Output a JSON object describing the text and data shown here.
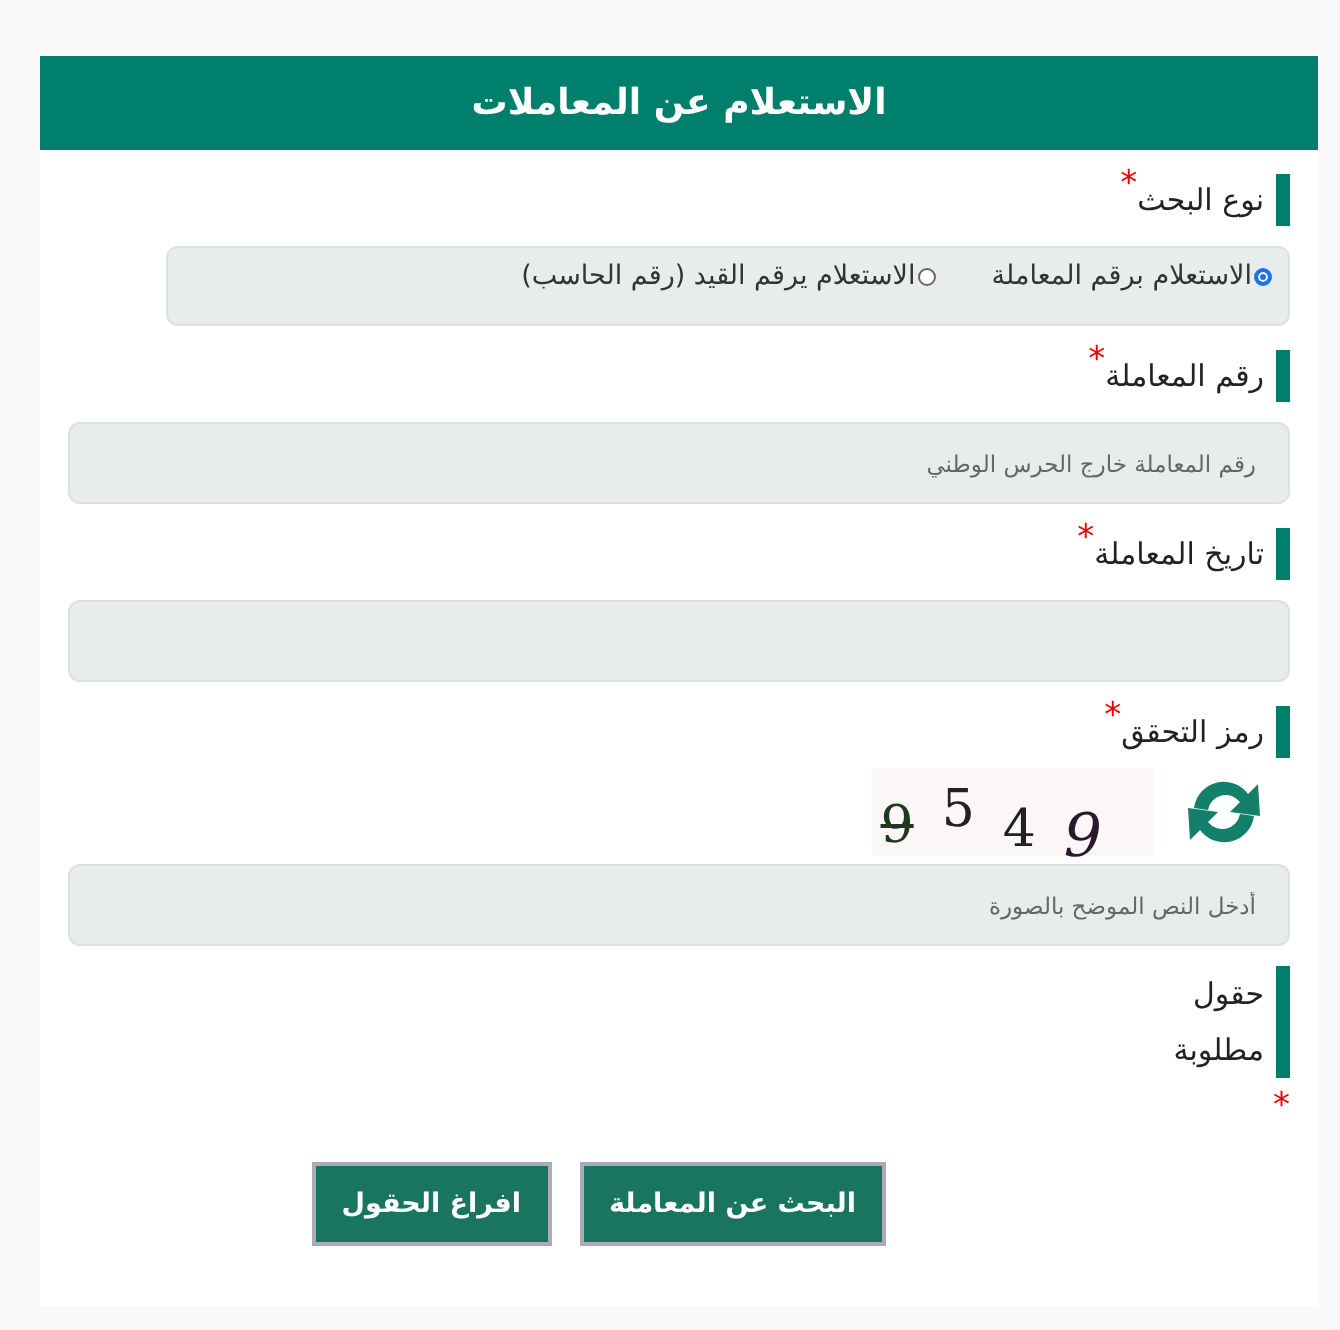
{
  "header": {
    "title": "الاستعلام عن المعاملات"
  },
  "required_mark": "*",
  "search_type": {
    "label": "نوع البحث",
    "required": true,
    "options": [
      {
        "label": "الاستعلام برقم المعاملة",
        "selected": true
      },
      {
        "label": "الاستعلام يرقم القيد (رقم الحاسب)",
        "selected": false
      }
    ]
  },
  "fields": [
    {
      "label": "رقم المعاملة",
      "required": true,
      "placeholder": "رقم المعاملة خارج الحرس الوطني"
    },
    {
      "label": "تاريخ المعاملة",
      "required": true
    }
  ],
  "captcha": {
    "label": "رمز التحقق",
    "required": true,
    "characters": [
      "9",
      "4",
      "5",
      "9"
    ],
    "placeholder": "أدخل النص الموضح بالصورة"
  },
  "required_note": {
    "text": "حقول مطلوبة"
  },
  "buttons": [
    {
      "label": "البحث عن المعاملة"
    },
    {
      "label": "افراغ الحقول"
    }
  ]
}
